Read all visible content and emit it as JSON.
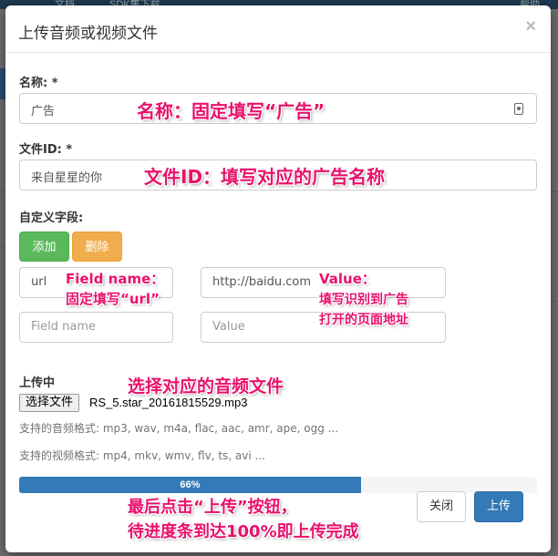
{
  "background": {
    "top_fragments": [
      "文档",
      "SDK集下载",
      "帮助"
    ]
  },
  "modal": {
    "title": "上传音频或视频文件",
    "close_glyph": "×",
    "name_label": "名称: *",
    "name_value": "广告",
    "fileid_label": "文件ID: *",
    "fileid_value": "来自星星的你",
    "custom_label": "自定义字段:",
    "add_button": "添加",
    "delete_button": "删除",
    "field_rows": [
      {
        "name_value": "url",
        "value_value": "http://baidu.com"
      },
      {
        "name_placeholder": "Field name",
        "value_placeholder": "Value"
      }
    ],
    "uploading_label": "上传中",
    "choose_file_button": "选择文件",
    "file_name": "RS_5.star_20161815529.mp3",
    "audio_formats": "支持的音频格式: mp3, wav, m4a, flac, aac, amr, ape, ogg ...",
    "video_formats": "支持的视频格式: mp4, mkv, wmv, flv, ts, avi ...",
    "progress": {
      "percent": 66,
      "label": "66%"
    },
    "close_button": "关闭",
    "upload_button": "上传"
  },
  "annotations": {
    "name_note": "名称：固定填写“广告”",
    "fileid_note": "文件ID：填写对应的广告名称",
    "field_name_note_1": "Field name：",
    "field_name_note_2": "固定填写“url”",
    "value_note_1": "Value：",
    "value_note_2": "填写识别到广告",
    "value_note_3": "打开的页面地址",
    "file_note": "选择对应的音频文件",
    "final_note_1": "最后点击“上传”按钮，",
    "final_note_2": "待进度条到达100%即上传完成"
  },
  "colors": {
    "annotation": "#e8126c",
    "progress": "#337ab7",
    "add": "#5cb85c",
    "delete": "#f0ad4e"
  }
}
